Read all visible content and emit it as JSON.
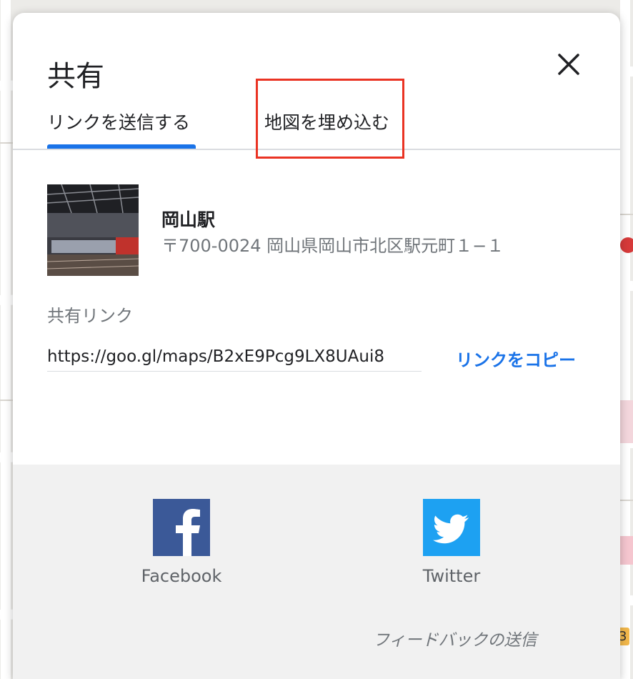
{
  "dialog": {
    "title": "共有",
    "tabs": [
      {
        "label": "リンクを送信する",
        "active": true
      },
      {
        "label": "地図を埋め込む",
        "active": false
      }
    ]
  },
  "place": {
    "name": "岡山駅",
    "address": "〒700-0024 岡山県岡山市北区駅元町１−１"
  },
  "share_link": {
    "label": "共有リンク",
    "url": "https://goo.gl/maps/B2xE9Pcg9LX8UAui8",
    "copy_label": "リンクをコピー"
  },
  "social": [
    {
      "name": "Facebook",
      "color": "#3b5998"
    },
    {
      "name": "Twitter",
      "color": "#1da1f2"
    }
  ],
  "feedback": "フィードバックの送信",
  "colors": {
    "accent": "#1a73e8",
    "highlight": "#ea3323"
  }
}
